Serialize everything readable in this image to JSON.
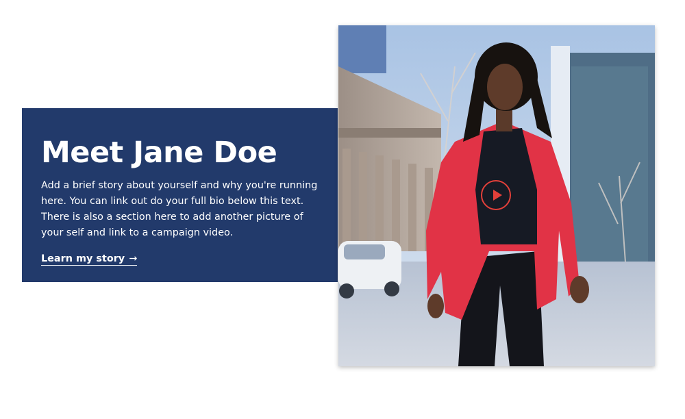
{
  "story": {
    "title": "Meet Jane Doe",
    "body": "Add a brief story about yourself and why you're running here. You can link out do your full bio below this text. There is also a section here to add another picture of your self and link to a campaign video.",
    "link_label": "Learn my story",
    "link_arrow": "→"
  },
  "media": {
    "play_icon": "play-icon"
  },
  "colors": {
    "card_background": "#223a6b",
    "accent_red": "#e3403a",
    "text": "#ffffff"
  }
}
